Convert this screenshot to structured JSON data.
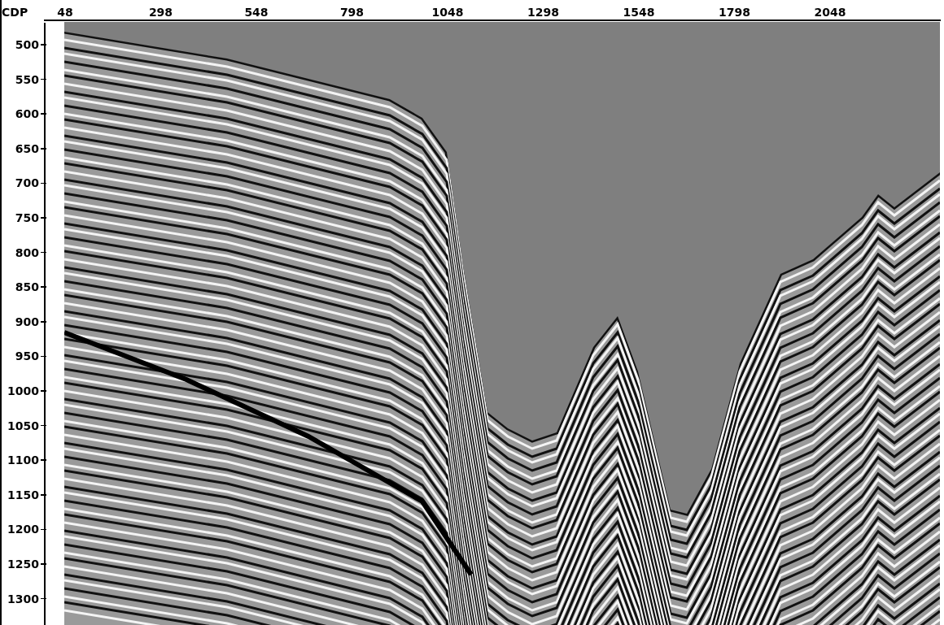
{
  "x_axis": {
    "title": "CDP",
    "ticks": [
      "48",
      "298",
      "548",
      "798",
      "1048",
      "1298",
      "1548",
      "1798",
      "2048"
    ]
  },
  "y_axis": {
    "ticks": [
      "500",
      "550",
      "600",
      "650",
      "700",
      "750",
      "800",
      "850",
      "900",
      "950",
      "1000",
      "1050",
      "1100",
      "1150",
      "1200",
      "1250",
      "1300"
    ]
  }
}
